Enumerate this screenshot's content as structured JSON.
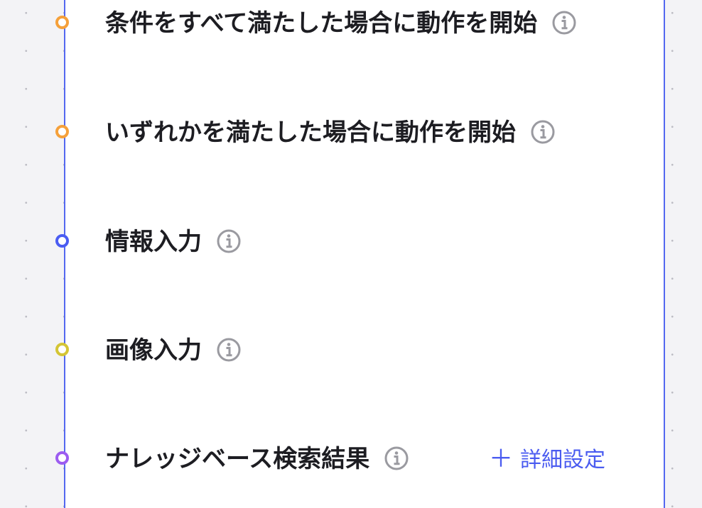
{
  "nodes": [
    {
      "label": "条件をすべて満たした場合に動作を開始",
      "color": "#f5a03a",
      "info_icon": "info-circle-icon"
    },
    {
      "label": "いずれかを満たした場合に動作を開始",
      "color": "#f5a03a",
      "info_icon": "info-circle-icon"
    },
    {
      "label": "情報入力",
      "color": "#4a5cf2",
      "info_icon": "info-circle-icon"
    },
    {
      "label": "画像入力",
      "color": "#d4c535",
      "info_icon": "info-circle-icon"
    },
    {
      "label": "ナレッジベース検索結果",
      "color": "#9c5cf0",
      "info_icon": "info-circle-icon"
    }
  ],
  "detail_link": {
    "icon": "plus-icon",
    "plus": "＋",
    "label": "詳細設定",
    "color": "#4a5bf0"
  },
  "colors": {
    "panel_border": "#5468f0",
    "background": "#f3f3f6",
    "info_icon": "#9a9aa0"
  }
}
